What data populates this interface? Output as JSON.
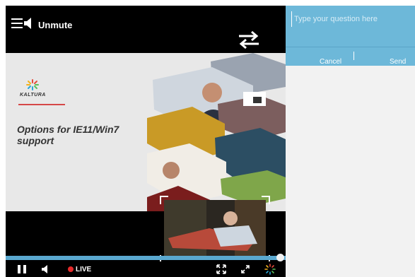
{
  "player": {
    "unmute_label": "Unmute",
    "live_label": "LIVE",
    "progress": 0.98
  },
  "slide": {
    "brand": "KALTURA",
    "title": "Options for IE11/Win7 support"
  },
  "question_panel": {
    "placeholder": "Type your question here",
    "cancel_label": "Cancel",
    "send_label": "Send"
  },
  "colors": {
    "accent": "#6db8d9",
    "progress": "#5aa8cf",
    "live": "#e52a2a"
  }
}
